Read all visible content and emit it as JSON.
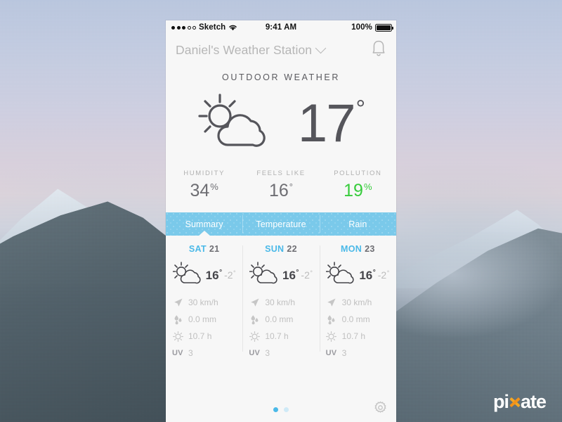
{
  "status_bar": {
    "signal_dots_filled": 3,
    "signal_dots_total": 5,
    "carrier": "Sketch",
    "wifi_icon": "wifi-icon",
    "time": "9:41 AM",
    "battery_percent": "100%",
    "battery_icon": "battery-full-icon"
  },
  "nav": {
    "title": "Daniel's Weather Station",
    "caret_icon": "chevron-down-icon",
    "bell_icon": "bell-icon"
  },
  "section": {
    "title": "OUTDOOR WEATHER"
  },
  "current": {
    "condition_icon": "sun-behind-cloud-icon",
    "temperature": "17",
    "degree": "°"
  },
  "stats": [
    {
      "label": "HUMIDITY",
      "value": "34",
      "suffix": "%",
      "color": "#6e6e73",
      "name": "humidity"
    },
    {
      "label": "FEELS LIKE",
      "value": "16",
      "suffix": "°",
      "color": "#6e6e73",
      "name": "feels-like"
    },
    {
      "label": "POLLUTION",
      "value": "19",
      "suffix": "%",
      "color": "#37cc3c",
      "name": "pollution"
    }
  ],
  "tabs": [
    {
      "label": "Summary",
      "active": true
    },
    {
      "label": "Temperature",
      "active": false
    },
    {
      "label": "Rain",
      "active": false
    }
  ],
  "forecast": [
    {
      "day": "SAT",
      "date": "21",
      "icon": "sun-behind-cloud-icon",
      "high": "16",
      "high_deg": "°",
      "low": "-2",
      "low_deg": "°",
      "wind": "30 km/h",
      "rain": "0.0 mm",
      "sun": "10.7 h",
      "uv_label": "UV",
      "uv": "3"
    },
    {
      "day": "SUN",
      "date": "22",
      "icon": "sun-behind-cloud-icon",
      "high": "16",
      "high_deg": "°",
      "low": "-2",
      "low_deg": "°",
      "wind": "30 km/h",
      "rain": "0.0 mm",
      "sun": "10.7 h",
      "uv_label": "UV",
      "uv": "3"
    },
    {
      "day": "MON",
      "date": "23",
      "icon": "sun-behind-cloud-icon",
      "high": "16",
      "high_deg": "°",
      "low": "-2",
      "low_deg": "°",
      "wind": "30 km/h",
      "rain": "0.0 mm",
      "sun": "10.7 h",
      "uv_label": "UV",
      "uv": "3"
    }
  ],
  "metric_icons": {
    "wind": "navigation-arrow-icon",
    "rain": "raindrops-icon",
    "sun": "sun-icon",
    "uv": "uv-label"
  },
  "bottom_bar": {
    "page_dots_total": 2,
    "page_dot_active_index": 0,
    "gear_icon": "gear-icon"
  },
  "watermark": {
    "text_before": "pi",
    "text_after": "ate",
    "mark_icon": "pixate-x-icon"
  },
  "colors": {
    "accent_blue": "#4ab9e8",
    "tab_bar_blue": "#7ac9ea",
    "pollution_green": "#37cc3c",
    "screen_bg": "#f7f7f7",
    "text_dark": "#55555b",
    "text_muted": "#b0b0b0",
    "watermark_orange": "#f5a623"
  }
}
